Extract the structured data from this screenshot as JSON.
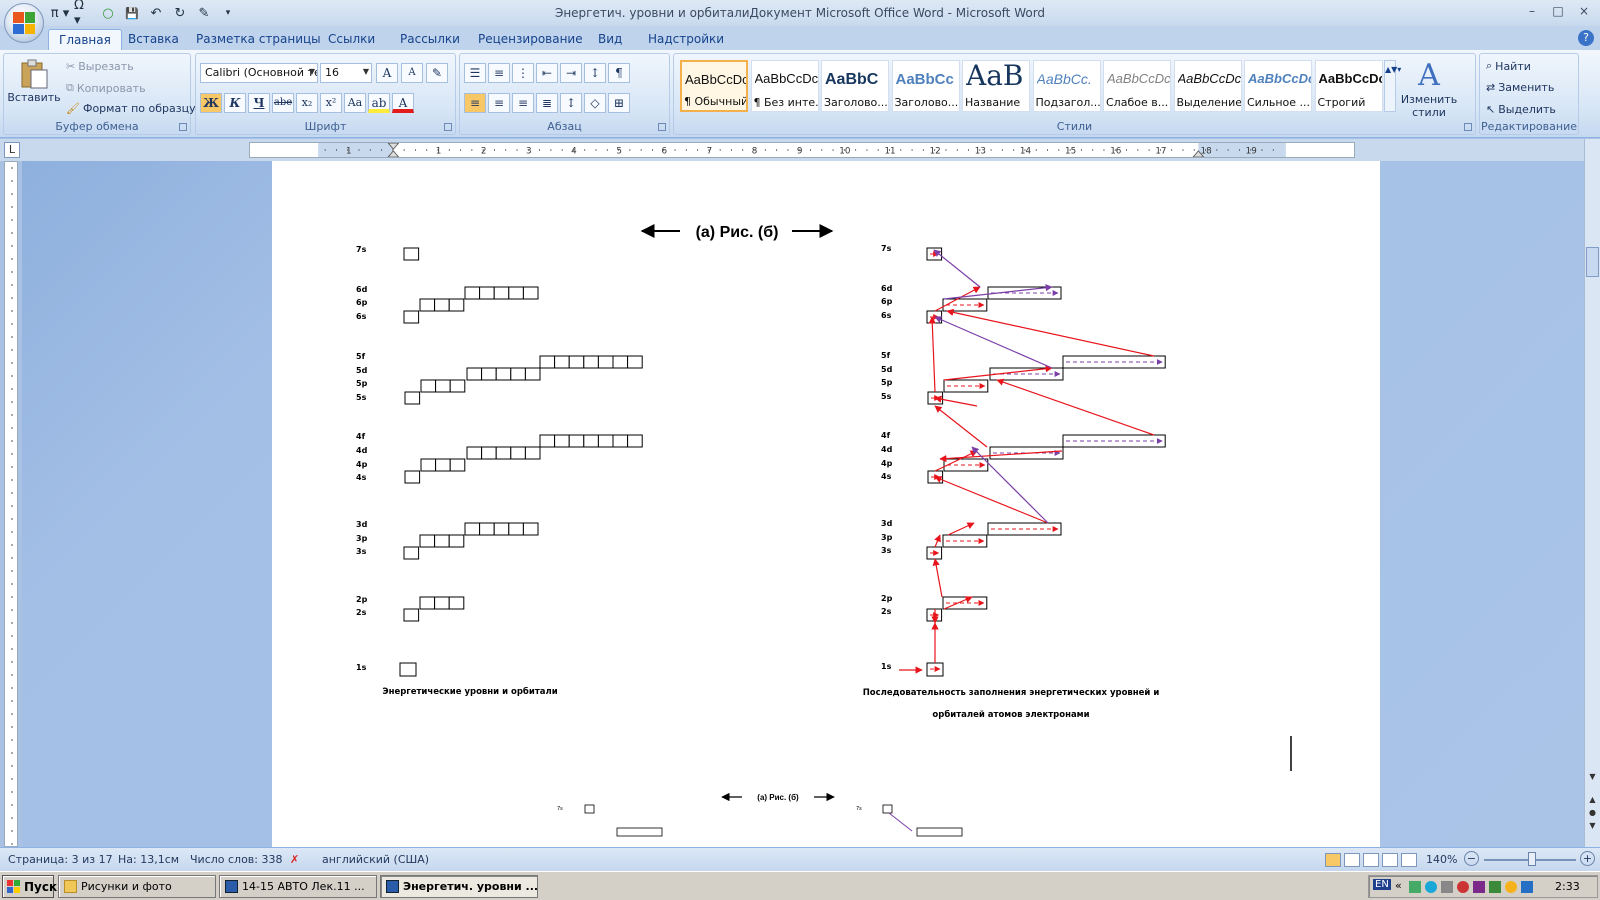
{
  "window": {
    "title": "Энергетич. уровни и орбиталиДокумент Microsoft Office Word - Microsoft Word",
    "controls": [
      "–",
      "□",
      "×"
    ]
  },
  "qat": [
    "π ▾",
    "Ω ▾",
    "○",
    "💾",
    "↶",
    "↻",
    "✎",
    "▾"
  ],
  "tabs": [
    "Главная",
    "Вставка",
    "Разметка страницы",
    "Ссылки",
    "Рассылки",
    "Рецензирование",
    "Вид",
    "Надстройки"
  ],
  "active_tab": "Главная",
  "ribbon": {
    "clipboard": {
      "label": "Буфер обмена",
      "paste": "Вставить",
      "cut": "Вырезать",
      "copy": "Копировать",
      "format_painter": "Формат по образцу"
    },
    "font": {
      "label": "Шрифт",
      "font_name": "Calibri (Основной те",
      "font_size": "16",
      "buttons": [
        "Ж",
        "К",
        "Ч",
        "abe",
        "x₂",
        "x²",
        "Aa"
      ]
    },
    "paragraph": {
      "label": "Абзац"
    },
    "styles": {
      "label": "Стили",
      "items": [
        {
          "sample": "AaBbCcDc",
          "name": "¶ Обычный",
          "selected": true
        },
        {
          "sample": "AaBbCcDc",
          "name": "¶ Без инте..."
        },
        {
          "sample": "AaBbC",
          "name": "Заголово..."
        },
        {
          "sample": "AaBbCc",
          "name": "Заголово..."
        },
        {
          "sample": "AaB",
          "name": "Название"
        },
        {
          "sample": "AaBbCc.",
          "name": "Подзагол..."
        },
        {
          "sample": "AaBbCcDc",
          "name": "Слабое в..."
        },
        {
          "sample": "AaBbCcDc",
          "name": "Выделение"
        },
        {
          "sample": "AaBbCcDc",
          "name": "Сильное ..."
        },
        {
          "sample": "AaBbCcDc",
          "name": "Строгий"
        }
      ],
      "change_styles": "Изменить стили"
    },
    "editing": {
      "label": "Редактирование",
      "find": "Найти",
      "replace": "Заменить",
      "select": "Выделить"
    }
  },
  "ruler": {
    "numbers": [
      "1",
      "1",
      "2",
      "3",
      "4",
      "5",
      "6",
      "7",
      "8",
      "9",
      "10",
      "11",
      "12",
      "13",
      "14",
      "15",
      "16",
      "17",
      "18",
      "19"
    ]
  },
  "document": {
    "heading": "(а) Рис. (б)",
    "left_levels": [
      "7s",
      "6d",
      "6p",
      "6s",
      "5f",
      "5d",
      "5p",
      "5s",
      "4f",
      "4d",
      "4p",
      "4s",
      "3d",
      "3p",
      "3s",
      "2p",
      "2s",
      "1s"
    ],
    "right_levels": [
      "7s",
      "6d",
      "6p",
      "6s",
      "5f",
      "5d",
      "5p",
      "5s",
      "4f",
      "4d",
      "4p",
      "4s",
      "3d",
      "3p",
      "3s",
      "2p",
      "2s",
      "1s"
    ],
    "left_caption": "Энергетические уровни и орбитали",
    "right_caption_line1": "Последовательность заполнения энергетических уровней и",
    "right_caption_line2": "орбиталей атомов электронами",
    "next_heading": "(а) Рис. (б)",
    "next_left_label": "7s",
    "next_right_label": "7s"
  },
  "status": {
    "page": "Страница: 3 из 17",
    "position": "На: 13,1см",
    "words": "Число слов: 338",
    "language": "английский (США)",
    "zoom": "140%"
  },
  "taskbar": {
    "start": "Пуск",
    "tasks": [
      "Рисунки и фото",
      "14-15  АВТО  Лек.11 ...",
      "Энергетич. уровни ..."
    ],
    "lang": "EN",
    "clock": "2:33"
  },
  "colors": {
    "arrow_red": "#e8141c",
    "arrow_purple": "#7b3fa8",
    "ribbon_bg": "#d6e5f5",
    "doc_bg": "#a3bfe6"
  }
}
